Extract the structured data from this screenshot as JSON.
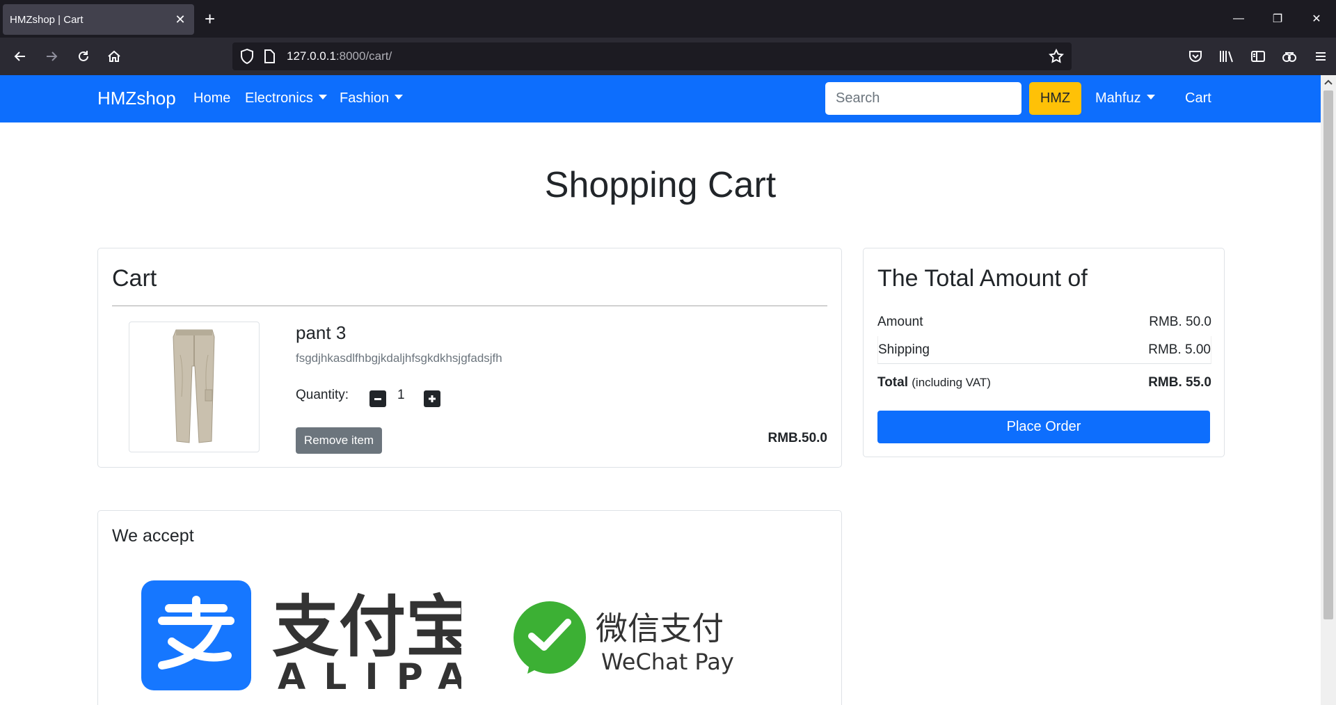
{
  "browser": {
    "tab_title": "HMZshop | Cart",
    "url_host": "127.0.0.1",
    "url_path": ":8000/cart/"
  },
  "nav": {
    "brand": "HMZshop",
    "home": "Home",
    "electronics": "Electronics",
    "fashion": "Fashion",
    "search_placeholder": "Search",
    "search_button": "HMZ",
    "user": "Mahfuz",
    "cart": "Cart",
    "accent_color": "#0d6efd",
    "search_button_color": "#ffc107"
  },
  "page": {
    "title": "Shopping Cart"
  },
  "cart": {
    "heading": "Cart",
    "items": [
      {
        "name": "pant 3",
        "description": "fsgdjhkasdlfhbgjkdaljhfsgkdkhsjgfadsjfh",
        "quantity_label": "Quantity:",
        "quantity": "1",
        "remove_label": "Remove item",
        "price": "RMB.50.0"
      }
    ]
  },
  "summary": {
    "heading": "The Total Amount of",
    "amount_label": "Amount",
    "amount_value": "RMB. 50.0",
    "shipping_label": "Shipping",
    "shipping_value": "RMB. 5.00",
    "total_label": "Total",
    "total_note": "(including VAT)",
    "total_value": "RMB. 55.0",
    "place_order": "Place Order"
  },
  "payment": {
    "heading": "We accept",
    "alipay_cn": "支付宝",
    "alipay_en": "ALIPAY",
    "wechat_cn": "微信支付",
    "wechat_en": "WeChat Pay"
  }
}
